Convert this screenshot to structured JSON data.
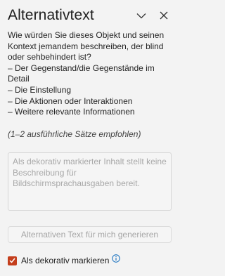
{
  "pane": {
    "title": "Alternativtext",
    "collapse_icon": "chevron-down-icon",
    "close_icon": "close-icon"
  },
  "description": {
    "lines": [
      "Wie würden Sie dieses Objekt und seinen",
      "Kontext jemandem beschreiben, der blind",
      "oder sehbehindert ist?",
      "– Der Gegenstand/die Gegenstände im",
      "Detail",
      "– Die Einstellung",
      "– Die Aktionen oder Interaktionen",
      "– Weitere relevante Informationen"
    ]
  },
  "hint": "(1–2 ausführliche Sätze empfohlen)",
  "alt_text_input": {
    "value": "",
    "placeholder_lines": [
      "Als dekorativ markierter Inhalt stellt keine",
      "Beschreibung für",
      "Bildschirmsprachausgaben bereit."
    ],
    "enabled": false
  },
  "generate_button": {
    "label": "Alternativen Text für mich generieren",
    "enabled": false
  },
  "decorative": {
    "label": "Als dekorativ markieren",
    "checked": true,
    "info_icon": "info-icon"
  },
  "colors": {
    "accent": "#c43e1c",
    "info": "#0f6cbd",
    "background": "#f3f3f3"
  }
}
